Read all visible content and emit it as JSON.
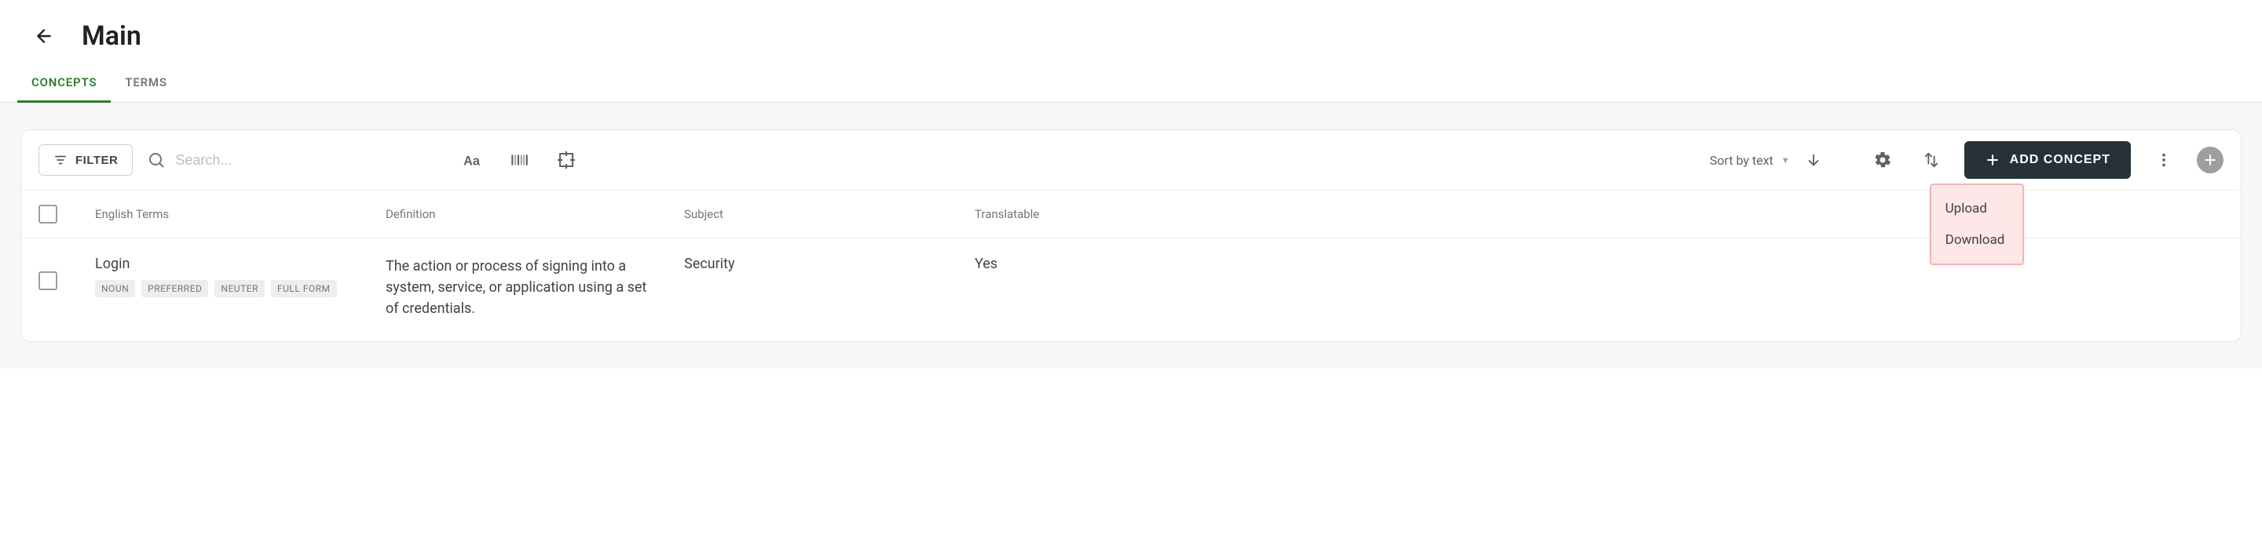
{
  "header": {
    "title": "Main"
  },
  "tabs": [
    {
      "label": "CONCEPTS",
      "active": true
    },
    {
      "label": "TERMS",
      "active": false
    }
  ],
  "toolbar": {
    "filter_label": "FILTER",
    "search_placeholder": "Search...",
    "sort_label": "Sort by text",
    "add_concept_label": "ADD CONCEPT"
  },
  "menu": {
    "items": [
      {
        "label": "Upload"
      },
      {
        "label": "Download"
      }
    ]
  },
  "table": {
    "columns": {
      "terms": "English Terms",
      "definition": "Definition",
      "subject": "Subject",
      "translatable": "Translatable"
    },
    "rows": [
      {
        "term": "Login",
        "tags": [
          "NOUN",
          "PREFERRED",
          "NEUTER",
          "FULL FORM"
        ],
        "definition": "The action or process of signing into a system, service, or application using a set of credentials.",
        "subject": "Security",
        "translatable": "Yes"
      }
    ]
  }
}
